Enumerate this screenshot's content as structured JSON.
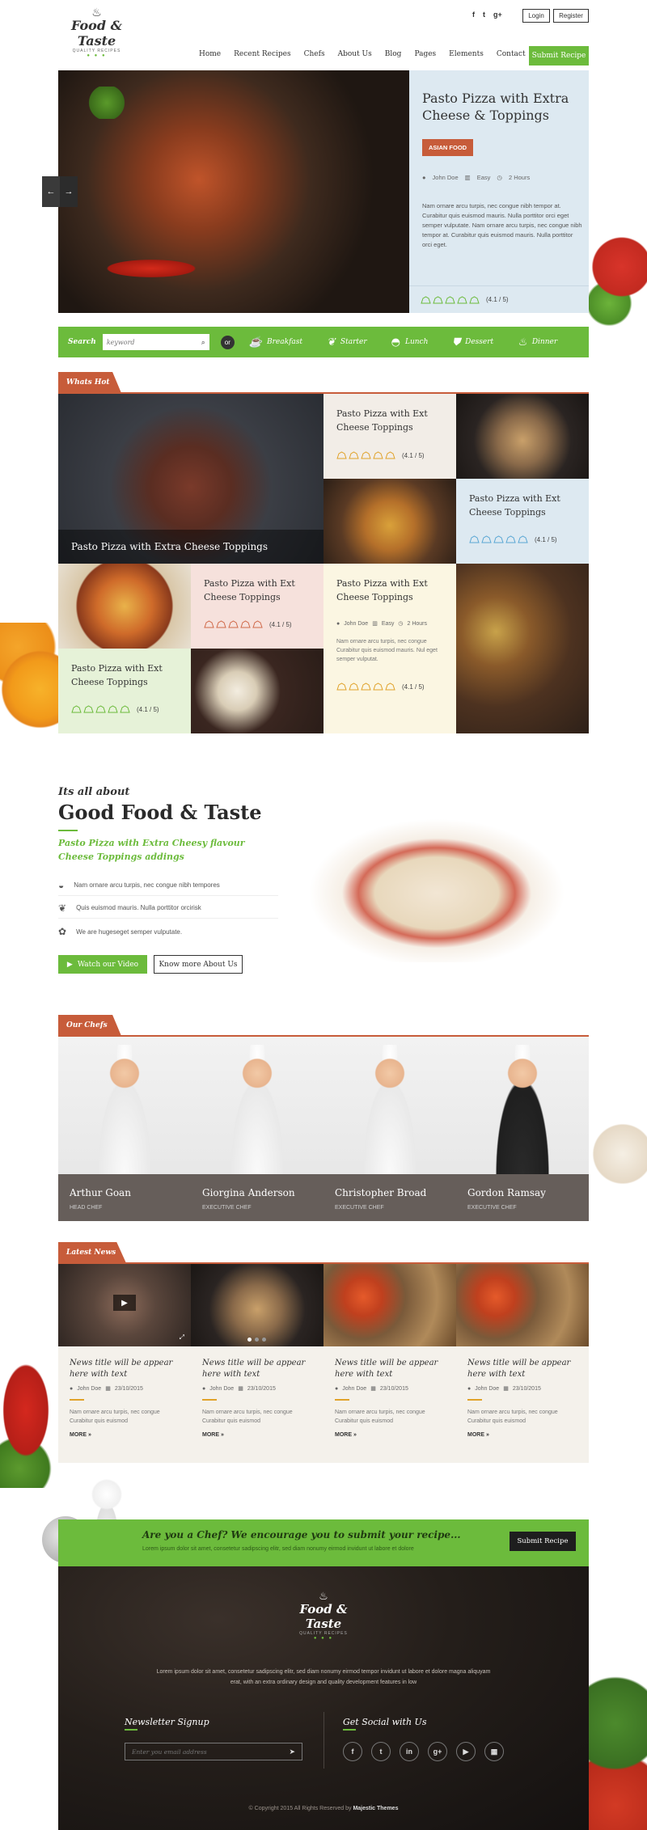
{
  "brand": {
    "name": "Food & Taste",
    "tagline": "QUALITY RECIPES"
  },
  "header": {
    "login": "Login",
    "register": "Register",
    "social": [
      "f",
      "t",
      "g+"
    ],
    "nav": [
      "Home",
      "Recent Recipes",
      "Chefs",
      "About Us",
      "Blog",
      "Pages",
      "Elements",
      "Contact"
    ],
    "submit": "Submit Recipe"
  },
  "hero": {
    "title": "Pasto Pizza with Extra Cheese & Toppings",
    "badge": "ASIAN FOOD",
    "author": "John Doe",
    "level": "Easy",
    "time": "2 Hours",
    "text": "Nam ornare arcu turpis, nec congue nibh tempor at. Curabitur quis euismod mauris. Nulla porttitor orci eget semper vulputate. Nam ornare arcu turpis, nec congue nibh tempor at. Curabitur quis euismod mauris. Nulla porttitor orci eget.",
    "rating": "(4.1 / 5)",
    "rating_value": 4.1,
    "prev": "←",
    "next": "→"
  },
  "search": {
    "label": "Search",
    "placeholder": "keyword",
    "or": "or",
    "categories": [
      "Breakfast",
      "Starter",
      "Lunch",
      "Dessert",
      "Dinner"
    ]
  },
  "whats_hot": {
    "tag": "Whats Hot",
    "feature_title": "Pasto Pizza with Extra Cheese Toppings",
    "card1": {
      "title": "Pasto Pizza with Ext Cheese Toppings",
      "rating": "(4.1 / 5)"
    },
    "card2": {
      "title": "Pasto Pizza with Ext Cheese Toppings",
      "rating": "(4.1 / 5)"
    },
    "card3": {
      "title": "Pasto Pizza with Ext Cheese Toppings",
      "rating": "(4.1 / 5)"
    },
    "card4": {
      "title": "Pasto Pizza with Ext Cheese Toppings",
      "author": "John Doe",
      "level": "Easy",
      "time": "2 Hours",
      "text": "Nam ornare arcu turpis, nec congue Curabitur quis euismod mauris. Nul eget semper vulputat.",
      "rating": "(4.1 / 5)"
    },
    "card5": {
      "title": "Pasto Pizza with Ext Cheese Toppings",
      "rating": "(4.1 / 5)"
    }
  },
  "about": {
    "kicker": "Its all about",
    "title": "Good Food & Taste",
    "subtitle": "Pasto Pizza with Extra Cheesy flavour Cheese Toppings addings",
    "features": [
      "Nam ornare arcu turpis, nec congue nibh tempores",
      "Quis euismod mauris. Nulla porttitor orcirisk",
      "We are hugeseget semper vulputate."
    ],
    "watch": "Watch our Video",
    "more": "Know more About Us"
  },
  "chefs": {
    "tag": "Our Chefs",
    "items": [
      {
        "name": "Arthur Goan",
        "role": "HEAD CHEF"
      },
      {
        "name": "Giorgina Anderson",
        "role": "EXECUTIVE CHEF"
      },
      {
        "name": "Christopher Broad",
        "role": "EXECUTIVE CHEF"
      },
      {
        "name": "Gordon Ramsay",
        "role": "EXECUTIVE CHEF"
      }
    ]
  },
  "news": {
    "tag": "Latest News",
    "items": [
      {
        "title": "News title will be appear here with text",
        "author": "John Doe",
        "date": "23/10/2015",
        "text": "Nam ornare arcu turpis, nec congue Curabitur quis euismod",
        "more": "MORE »"
      },
      {
        "title": "News title will be appear here with text",
        "author": "John Doe",
        "date": "23/10/2015",
        "text": "Nam ornare arcu turpis, nec congue Curabitur quis euismod",
        "more": "MORE »"
      },
      {
        "title": "News title will be appear here with text",
        "author": "John Doe",
        "date": "23/10/2015",
        "text": "Nam ornare arcu turpis, nec congue Curabitur quis euismod",
        "more": "MORE »"
      },
      {
        "title": "News title will be appear here with text",
        "author": "John Doe",
        "date": "23/10/2015",
        "text": "Nam ornare arcu turpis, nec congue Curabitur quis euismod",
        "more": "MORE »"
      }
    ]
  },
  "cta": {
    "title": "Are you a Chef? We encourage you to submit your recipe...",
    "text": "Lorem ipsum dolor sit amet, consetetur sadipscing elitr, sed diam nonumy eirmod invidunt ut labore et dolore",
    "button": "Submit Recipe"
  },
  "footer": {
    "about": "Lorem ipsum dolor sit amet, consetetur sadipscing elitr, sed diam nonumy eirmod tempor invidunt ut labore et dolore magna aliquyam erat, with an extra ordinary design and quality development features in low",
    "newsletter_title": "Newsletter Signup",
    "newsletter_placeholder": "Enter you email address",
    "social_title": "Get Social with Us",
    "social": [
      "f",
      "t",
      "in",
      "g+",
      "▶",
      "▦"
    ],
    "copyright": "© Copyright 2015 All Rights Reserved by",
    "copyright_brand": "Majestic Themes"
  },
  "colors": {
    "green": "#6cbb3c",
    "red": "#c75c3a",
    "blue_panel": "#dde9f1",
    "footer": "#1d1a18"
  }
}
